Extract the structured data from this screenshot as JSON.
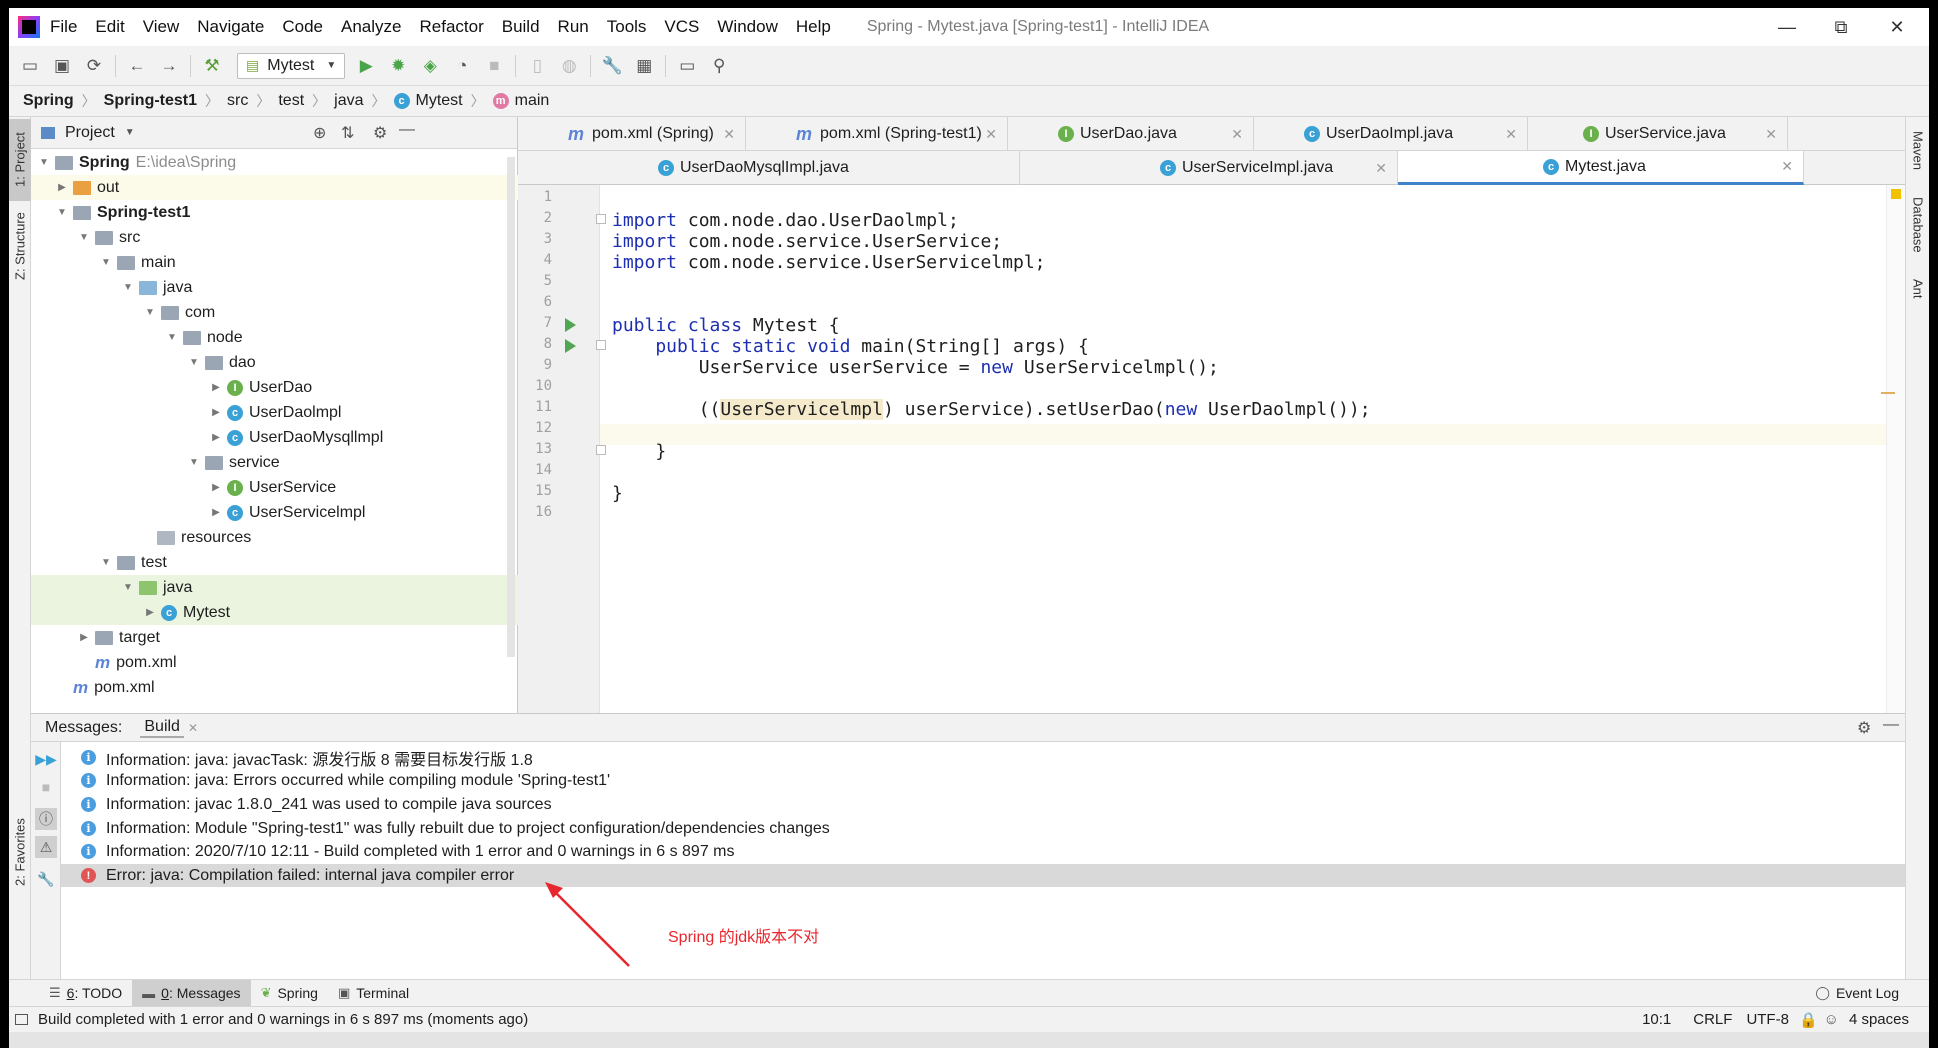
{
  "menu": [
    "File",
    "Edit",
    "View",
    "Navigate",
    "Code",
    "Analyze",
    "Refactor",
    "Build",
    "Run",
    "Tools",
    "VCS",
    "Window",
    "Help"
  ],
  "window_title": "Spring - Mytest.java [Spring-test1] - IntelliJ IDEA",
  "window_controls": {
    "minimize": "—",
    "restore": "⧉",
    "close": "✕"
  },
  "toolbar": {
    "run_config": "Mytest"
  },
  "breadcrumb": [
    "Spring",
    "Spring-test1",
    "src",
    "test",
    "java",
    "Mytest",
    "main"
  ],
  "left_stripe": {
    "project": "1: Project",
    "structure": "Z: Structure",
    "favorites": "2: Favorites"
  },
  "right_stripe": {
    "maven": "Maven",
    "database": "Database",
    "ant": "Ant"
  },
  "project_panel": {
    "title": "Project",
    "tree": [
      {
        "label": "Spring",
        "extra": "E:\\idea\\Spring",
        "bold": true
      },
      {
        "label": "out"
      },
      {
        "label": "Spring-test1",
        "bold": true
      },
      {
        "label": "src"
      },
      {
        "label": "main"
      },
      {
        "label": "java"
      },
      {
        "label": "com"
      },
      {
        "label": "node"
      },
      {
        "label": "dao"
      },
      {
        "label": "UserDao"
      },
      {
        "label": "UserDaolmpl"
      },
      {
        "label": "UserDaoMysqllmpl"
      },
      {
        "label": "service"
      },
      {
        "label": "UserService"
      },
      {
        "label": "UserServicelmpl"
      },
      {
        "label": "resources"
      },
      {
        "label": "test"
      },
      {
        "label": "java"
      },
      {
        "label": "Mytest"
      },
      {
        "label": "target"
      },
      {
        "label": "pom.xml"
      },
      {
        "label": "pom.xml"
      }
    ]
  },
  "editor_tabs_row1": [
    "pom.xml (Spring)",
    "pom.xml (Spring-test1)",
    "UserDao.java",
    "UserDaoImpl.java",
    "UserService.java"
  ],
  "editor_tabs_row2": [
    "UserDaoMysqlImpl.java",
    "UserServiceImpl.java",
    "Mytest.java"
  ],
  "code_lines": {
    "l2a": "import",
    "l2b": " com.node.dao.UserDaolmpl;",
    "l3a": "import",
    "l3b": " com.node.service.UserService;",
    "l4a": "import",
    "l4b": " com.node.service.UserServicelmpl;",
    "l7a": "public class",
    "l7b": " Mytest {",
    "l8a": "    public static void",
    "l8b": " main(String[] args) {",
    "l9a": "        UserService userService = ",
    "l9b": "new",
    "l9c": " UserServicelmpl();",
    "l11a": "        ((",
    "l11b": "UserServicelmpl",
    "l11c": ") userService).setUserDao(",
    "l11d": "new",
    "l11e": " UserDaolmpl());",
    "l13": "    }",
    "l15": "}"
  },
  "line_numbers": [
    "1",
    "2",
    "3",
    "4",
    "5",
    "6",
    "7",
    "8",
    "9",
    "10",
    "11",
    "12",
    "13",
    "14",
    "15",
    "16"
  ],
  "messages_panel": {
    "label": "Messages:",
    "tab": "Build",
    "items": [
      {
        "type": "info",
        "text": "Information: java: javacTask: 源发行版 8 需要目标发行版 1.8"
      },
      {
        "type": "info",
        "text": "Information: java: Errors occurred while compiling module 'Spring-test1'"
      },
      {
        "type": "info",
        "text": "Information: javac 1.8.0_241 was used to compile java sources"
      },
      {
        "type": "info",
        "text": "Information: Module \"Spring-test1\" was fully rebuilt due to project configuration/dependencies changes"
      },
      {
        "type": "info",
        "text": "Information: 2020/7/10 12:11 - Build completed with 1 error and 0 warnings in 6 s 897 ms"
      },
      {
        "type": "error",
        "text": "Error: java: Compilation failed: internal java compiler error"
      }
    ],
    "annotation": "Spring 的jdk版本不对"
  },
  "bottom_tabs": {
    "todo_num": "6",
    "todo": ": TODO",
    "messages_num": "0",
    "messages": ": Messages",
    "spring": "Spring",
    "terminal": "Terminal",
    "event_log": "Event Log"
  },
  "status": {
    "text": "Build completed with 1 error and 0 warnings in 6 s 897 ms (moments ago)",
    "position": "10:1",
    "line_sep": "CRLF",
    "encoding": "UTF-8",
    "indent": "4 spaces"
  },
  "colors": {
    "accent": "#4083c9",
    "error": "#e05555",
    "annotation": "#e8262d",
    "keyword": "#1d2fb0"
  }
}
